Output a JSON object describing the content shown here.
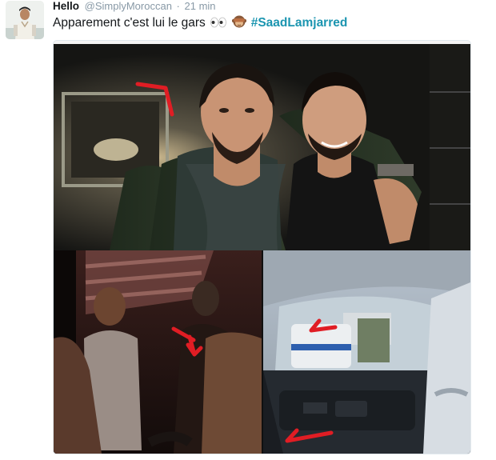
{
  "tweet": {
    "display_name": "Hello",
    "handle": "@SimplyMoroccan",
    "separator": "·",
    "time": "21 min",
    "text_before": "Apparement c'est lui le gars",
    "hashtag": "#SaadLamjarred",
    "emojis": [
      "eyes-emoji",
      "see-no-evil-monkey-emoji"
    ],
    "hashtag_color": "#1b95b0"
  },
  "media": {
    "photos": [
      "photo-two-men-nightclub",
      "photo-club-crowd",
      "photo-car-interior-police"
    ]
  }
}
